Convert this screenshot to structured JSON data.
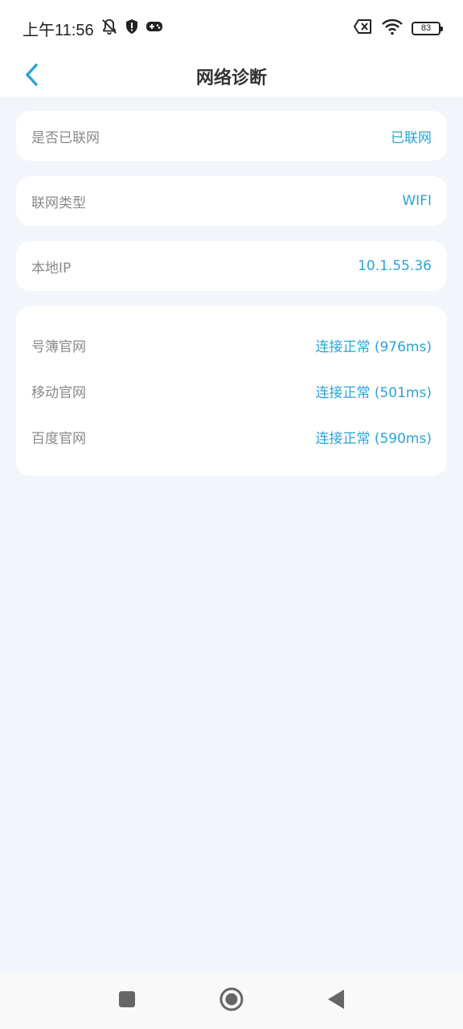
{
  "status_bar": {
    "time": "上午11:56",
    "battery_level": "83"
  },
  "header": {
    "title": "网络诊断"
  },
  "rows": {
    "connected": {
      "label": "是否已联网",
      "value": "已联网"
    },
    "network_type": {
      "label": "联网类型",
      "value": "WIFI"
    },
    "local_ip": {
      "label": "本地IP",
      "value": "10.1.55.36"
    }
  },
  "site_checks": [
    {
      "label": "号簿官网",
      "value": "连接正常 (976ms)"
    },
    {
      "label": "移动官网",
      "value": "连接正常 (501ms)"
    },
    {
      "label": "百度官网",
      "value": "连接正常 (590ms)"
    }
  ],
  "colors": {
    "accent": "#2aa4d5",
    "label": "#8a8a8a",
    "background": "#f2f6fa"
  }
}
